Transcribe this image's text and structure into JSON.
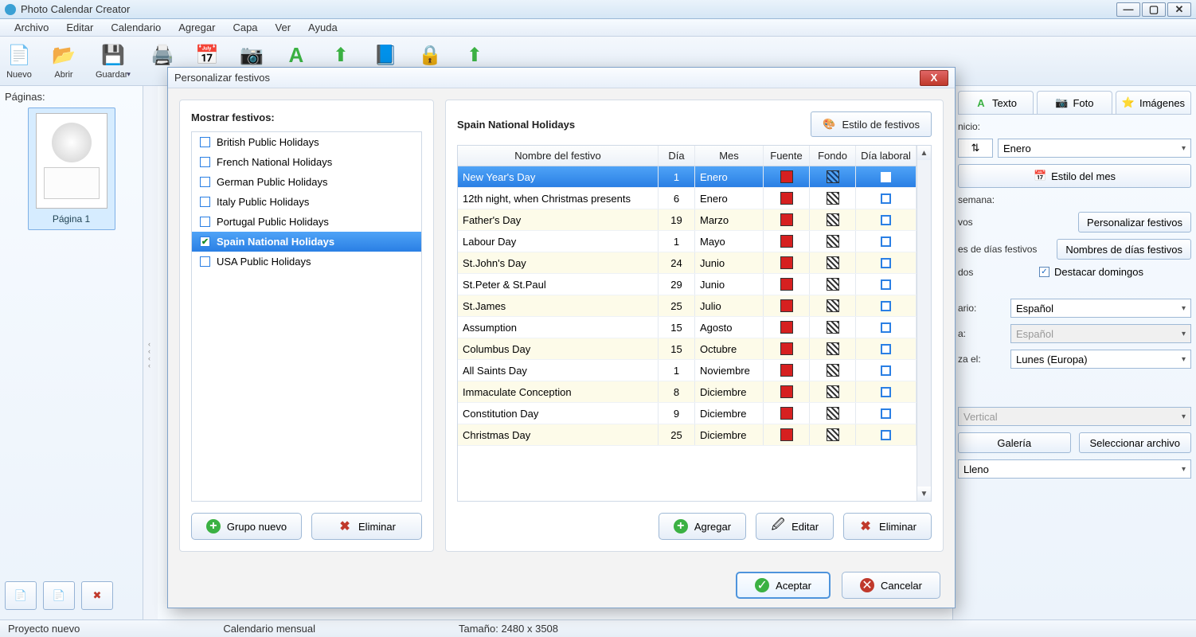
{
  "titlebar": {
    "title": "Photo Calendar Creator"
  },
  "menubar": [
    "Archivo",
    "Editar",
    "Calendario",
    "Agregar",
    "Capa",
    "Ver",
    "Ayuda"
  ],
  "toolbar": {
    "nuevo": "Nuevo",
    "abrir": "Abrir",
    "guardar": "Guardar"
  },
  "left": {
    "label": "Páginas:",
    "thumb_caption": "Página 1"
  },
  "right_tabs": {
    "texto": "Texto",
    "foto": "Foto",
    "imagenes": "Imágenes"
  },
  "right": {
    "inicio_label": "nicio:",
    "inicio_value": "Enero",
    "estilo_mes": "Estilo del mes",
    "semana_label": "semana:",
    "row_vos_label": "vos",
    "personalizar": "Personalizar festivos",
    "dias_label": "es de días festivos",
    "nombres_dias": "Nombres de días festivos",
    "dos_label": "dos",
    "destacar": "Destacar domingos",
    "ario_label": "ario:",
    "ario_value": "Español",
    "a_label": "a:",
    "a_value": "Español",
    "za_label": "za el:",
    "za_value": "Lunes (Europa)",
    "orient_value": "Vertical",
    "galeria": "Galería",
    "sel_archivo": "Seleccionar archivo",
    "lleno": "Lleno"
  },
  "status": {
    "proyecto": "Proyecto nuevo",
    "cal": "Calendario mensual",
    "tam": "Tamaño: 2480 x 3508"
  },
  "dialog": {
    "title": "Personalizar festivos",
    "mostrar": "Mostrar festivos:",
    "groups": [
      {
        "label": "British Public Holidays",
        "checked": false,
        "selected": false
      },
      {
        "label": "French National Holidays",
        "checked": false,
        "selected": false
      },
      {
        "label": "German Public Holidays",
        "checked": false,
        "selected": false
      },
      {
        "label": "Italy Public Holidays",
        "checked": false,
        "selected": false
      },
      {
        "label": "Portugal Public Holidays",
        "checked": false,
        "selected": false
      },
      {
        "label": "Spain National Holidays",
        "checked": true,
        "selected": true
      },
      {
        "label": "USA Public Holidays",
        "checked": false,
        "selected": false
      }
    ],
    "grupo_nuevo": "Grupo nuevo",
    "eliminar": "Eliminar",
    "right_title": "Spain National Holidays",
    "style_btn": "Estilo de festivos",
    "columns": {
      "name": "Nombre del festivo",
      "day": "Día",
      "month": "Mes",
      "font": "Fuente",
      "bg": "Fondo",
      "workday": "Día laboral"
    },
    "rows": [
      {
        "name": "New Year's Day",
        "day": "1",
        "month": "Enero",
        "selected": true,
        "alt": false
      },
      {
        "name": "12th night, when Christmas presents",
        "day": "6",
        "month": "Enero",
        "selected": false,
        "alt": false
      },
      {
        "name": "Father's Day",
        "day": "19",
        "month": "Marzo",
        "selected": false,
        "alt": true
      },
      {
        "name": "Labour Day",
        "day": "1",
        "month": "Mayo",
        "selected": false,
        "alt": false
      },
      {
        "name": "St.John's Day",
        "day": "24",
        "month": "Junio",
        "selected": false,
        "alt": true
      },
      {
        "name": "St.Peter & St.Paul",
        "day": "29",
        "month": "Junio",
        "selected": false,
        "alt": false
      },
      {
        "name": "St.James",
        "day": "25",
        "month": "Julio",
        "selected": false,
        "alt": true
      },
      {
        "name": "Assumption",
        "day": "15",
        "month": "Agosto",
        "selected": false,
        "alt": false
      },
      {
        "name": "Columbus Day",
        "day": "15",
        "month": "Octubre",
        "selected": false,
        "alt": true
      },
      {
        "name": "All Saints Day",
        "day": "1",
        "month": "Noviembre",
        "selected": false,
        "alt": false
      },
      {
        "name": "Immaculate Conception",
        "day": "8",
        "month": "Diciembre",
        "selected": false,
        "alt": true
      },
      {
        "name": "Constitution Day",
        "day": "9",
        "month": "Diciembre",
        "selected": false,
        "alt": false
      },
      {
        "name": "Christmas Day",
        "day": "25",
        "month": "Diciembre",
        "selected": false,
        "alt": true
      }
    ],
    "agregar": "Agregar",
    "editar": "Editar",
    "eliminar2": "Eliminar",
    "aceptar": "Aceptar",
    "cancelar": "Cancelar"
  }
}
